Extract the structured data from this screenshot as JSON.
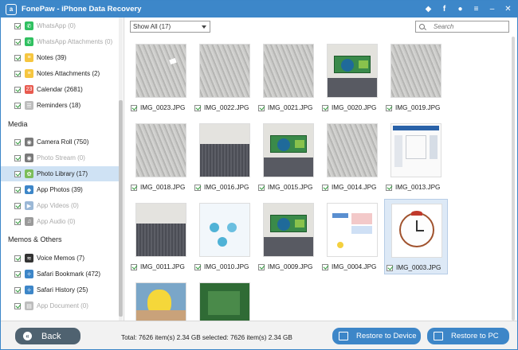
{
  "window": {
    "title": "FonePaw - iPhone Data Recovery",
    "logo_letter": "a"
  },
  "titlebar_icons": [
    "gem-icon",
    "facebook-icon",
    "chat-icon",
    "menu-icon",
    "minimize-icon",
    "close-icon"
  ],
  "sidebar": {
    "rows": [
      {
        "label": "WhatsApp (0)",
        "checked": true,
        "disabled": true,
        "icon": "whatsapp-icon",
        "icon_color": "#2fc060",
        "glyph": "✆"
      },
      {
        "label": "WhatsApp Attachments (0)",
        "checked": true,
        "disabled": true,
        "icon": "whatsapp-icon",
        "icon_color": "#2fc060",
        "glyph": "✆"
      },
      {
        "label": "Notes (39)",
        "checked": true,
        "disabled": false,
        "icon": "notes-icon",
        "icon_color": "#f6c640",
        "glyph": "≡"
      },
      {
        "label": "Notes Attachments (2)",
        "checked": true,
        "disabled": false,
        "icon": "notes-icon",
        "icon_color": "#f6c640",
        "glyph": "≡"
      },
      {
        "label": "Calendar (2681)",
        "checked": true,
        "disabled": false,
        "icon": "calendar-icon",
        "icon_color": "#e85a4f",
        "glyph": "23"
      },
      {
        "label": "Reminders (18)",
        "checked": true,
        "disabled": false,
        "icon": "reminders-icon",
        "icon_color": "#bdbdbd",
        "glyph": "☰"
      },
      {
        "label": "Camera Roll (750)",
        "checked": true,
        "disabled": false,
        "icon": "camera-icon",
        "icon_color": "#7a7a7a",
        "glyph": "◉"
      },
      {
        "label": "Photo Stream (0)",
        "checked": true,
        "disabled": true,
        "icon": "photo-stream-icon",
        "icon_color": "#7a7a7a",
        "glyph": "◉"
      },
      {
        "label": "Photo Library (17)",
        "checked": true,
        "disabled": false,
        "icon": "photo-library-icon",
        "icon_color": "#7bbd5a",
        "glyph": "✿",
        "selected": true
      },
      {
        "label": "App Photos (39)",
        "checked": true,
        "disabled": false,
        "icon": "app-photos-icon",
        "icon_color": "#3d86c8",
        "glyph": "◆"
      },
      {
        "label": "App Videos (0)",
        "checked": true,
        "disabled": true,
        "icon": "app-videos-icon",
        "icon_color": "#9bb8d6",
        "glyph": "▶"
      },
      {
        "label": "App Audio (0)",
        "checked": true,
        "disabled": true,
        "icon": "app-audio-icon",
        "icon_color": "#9a9a9a",
        "glyph": "♫"
      },
      {
        "label": "Voice Memos (7)",
        "checked": true,
        "disabled": false,
        "icon": "voice-memos-icon",
        "icon_color": "#333333",
        "glyph": "≋"
      },
      {
        "label": "Safari Bookmark (472)",
        "checked": true,
        "disabled": false,
        "icon": "safari-icon",
        "icon_color": "#3d86c8",
        "glyph": "✧"
      },
      {
        "label": "Safari History (25)",
        "checked": true,
        "disabled": false,
        "icon": "safari-icon",
        "icon_color": "#3d86c8",
        "glyph": "✧"
      },
      {
        "label": "App Document (0)",
        "checked": true,
        "disabled": true,
        "icon": "app-document-icon",
        "icon_color": "#bdbdbd",
        "glyph": "▤"
      }
    ],
    "groups": {
      "media": "Media",
      "memos": "Memos & Others"
    }
  },
  "toolbar": {
    "filter_value": "Show All (17)",
    "search_placeholder": "Search"
  },
  "photos": [
    {
      "name": "IMG_0023.JPG",
      "kind": "floor-paper"
    },
    {
      "name": "IMG_0022.JPG",
      "kind": "floor"
    },
    {
      "name": "IMG_0021.JPG",
      "kind": "floor"
    },
    {
      "name": "IMG_0020.JPG",
      "kind": "board"
    },
    {
      "name": "IMG_0019.JPG",
      "kind": "floor"
    },
    {
      "name": "IMG_0018.JPG",
      "kind": "floor"
    },
    {
      "name": "IMG_0016.JPG",
      "kind": "carpet"
    },
    {
      "name": "IMG_0015.JPG",
      "kind": "board"
    },
    {
      "name": "IMG_0014.JPG",
      "kind": "floor"
    },
    {
      "name": "IMG_0013.JPG",
      "kind": "screenshot"
    },
    {
      "name": "IMG_0011.JPG",
      "kind": "carpet"
    },
    {
      "name": "IMG_0010.JPG",
      "kind": "app"
    },
    {
      "name": "IMG_0009.JPG",
      "kind": "board"
    },
    {
      "name": "IMG_0004.JPG",
      "kind": "doc"
    },
    {
      "name": "IMG_0003.JPG",
      "kind": "clock",
      "selected": true
    },
    {
      "name": "",
      "kind": "cartoon",
      "partial": true
    },
    {
      "name": "",
      "kind": "green",
      "partial": true
    }
  ],
  "bottom": {
    "back_label": "Back",
    "status": "Total: 7626 item(s) 2.34 GB   selected: 7626 item(s) 2.34 GB",
    "restore_device_label": "Restore to Device",
    "restore_pc_label": "Restore to PC"
  }
}
